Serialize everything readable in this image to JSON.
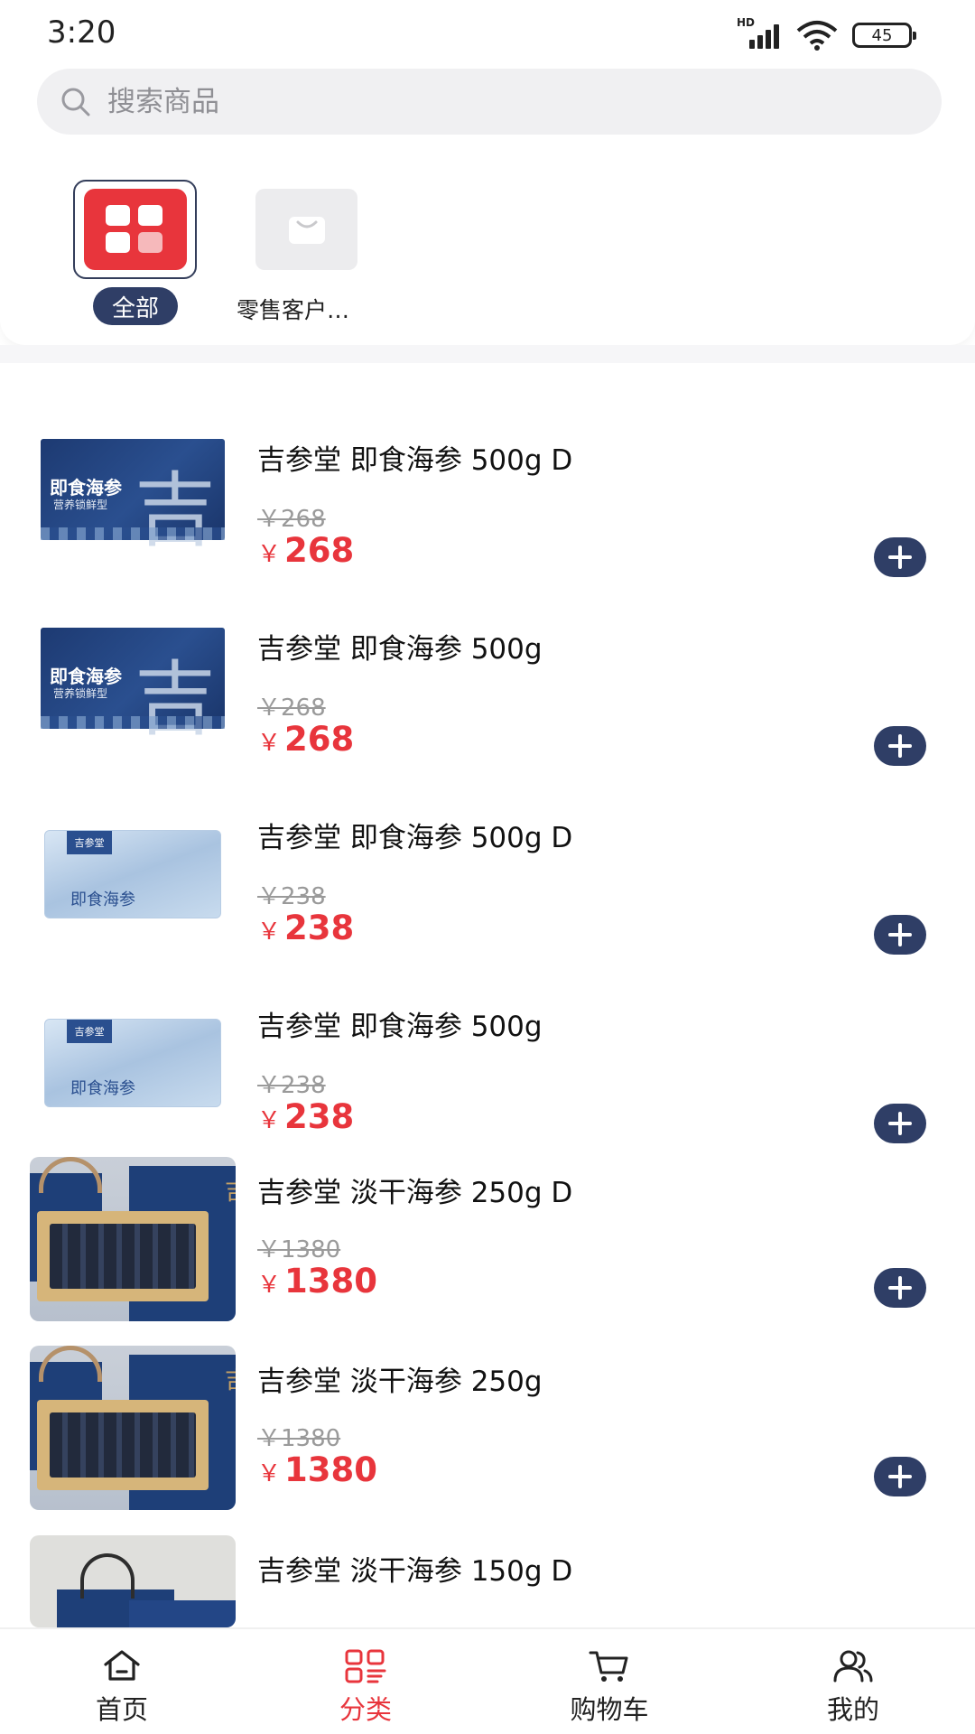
{
  "status_bar": {
    "time": "3:20",
    "battery": "45",
    "network": "HD"
  },
  "search": {
    "placeholder": "搜索商品"
  },
  "categories": [
    {
      "label": "全部",
      "icon": "grid-icon",
      "selected": true
    },
    {
      "label": "零售客户…",
      "icon": "shopping-bag-icon",
      "selected": false
    }
  ],
  "products": [
    {
      "name": "吉参堂 即食海参 500g D",
      "original_price": "￥268",
      "currency": "￥",
      "price": "268",
      "image": "navy-pack"
    },
    {
      "name": "吉参堂 即食海参 500g",
      "original_price": "￥268",
      "currency": "￥",
      "price": "268",
      "image": "navy-pack"
    },
    {
      "name": "吉参堂 即食海参 500g D",
      "original_price": "￥238",
      "currency": "￥",
      "price": "238",
      "image": "clear-pack"
    },
    {
      "name": "吉参堂 即食海参 500g",
      "original_price": "￥238",
      "currency": "￥",
      "price": "238",
      "image": "clear-pack"
    },
    {
      "name": "吉参堂 淡干海参 250g D",
      "original_price": "￥1380",
      "currency": "￥",
      "price": "1380",
      "image": "gift-box"
    },
    {
      "name": "吉参堂 淡干海参 250g",
      "original_price": "￥1380",
      "currency": "￥",
      "price": "1380",
      "image": "gift-box"
    },
    {
      "name": "吉参堂 淡干海参 150g D",
      "original_price": "",
      "currency": "",
      "price": "",
      "image": "gift-bag"
    }
  ],
  "bottom_nav": [
    {
      "label": "首页",
      "icon": "home-icon",
      "active": false
    },
    {
      "label": "分类",
      "icon": "category-icon",
      "active": true
    },
    {
      "label": "购物车",
      "icon": "cart-icon",
      "active": false
    },
    {
      "label": "我的",
      "icon": "user-icon",
      "active": false
    }
  ],
  "colors": {
    "accent_red": "#e8353c",
    "navy": "#2f3e66",
    "search_bg": "#f0f0f2"
  }
}
